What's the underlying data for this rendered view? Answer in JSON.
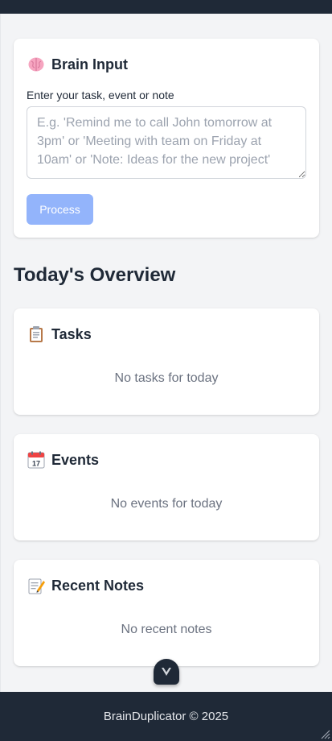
{
  "brain_input": {
    "title": "Brain Input",
    "icon": "brain-icon",
    "label": "Enter your task, event or note",
    "value": "",
    "placeholder": "E.g. 'Remind me to call John tomorrow at 3pm' or 'Meeting with team on Friday at 10am' or 'Note: Ideas for the new project'",
    "process_label": "Process"
  },
  "overview": {
    "heading": "Today's Overview",
    "tasks": {
      "title": "Tasks",
      "icon": "clipboard-icon",
      "empty": "No tasks for today"
    },
    "events": {
      "title": "Events",
      "icon": "calendar-icon",
      "empty": "No events for today"
    },
    "notes": {
      "title": "Recent Notes",
      "icon": "memo-icon",
      "empty": "No recent notes"
    }
  },
  "footer": {
    "text": "BrainDuplicator © 2025"
  },
  "colors": {
    "header_footer": "#1f2937",
    "background": "#f3f4f6",
    "button": "#93b4fb",
    "muted_text": "#6b7280"
  }
}
